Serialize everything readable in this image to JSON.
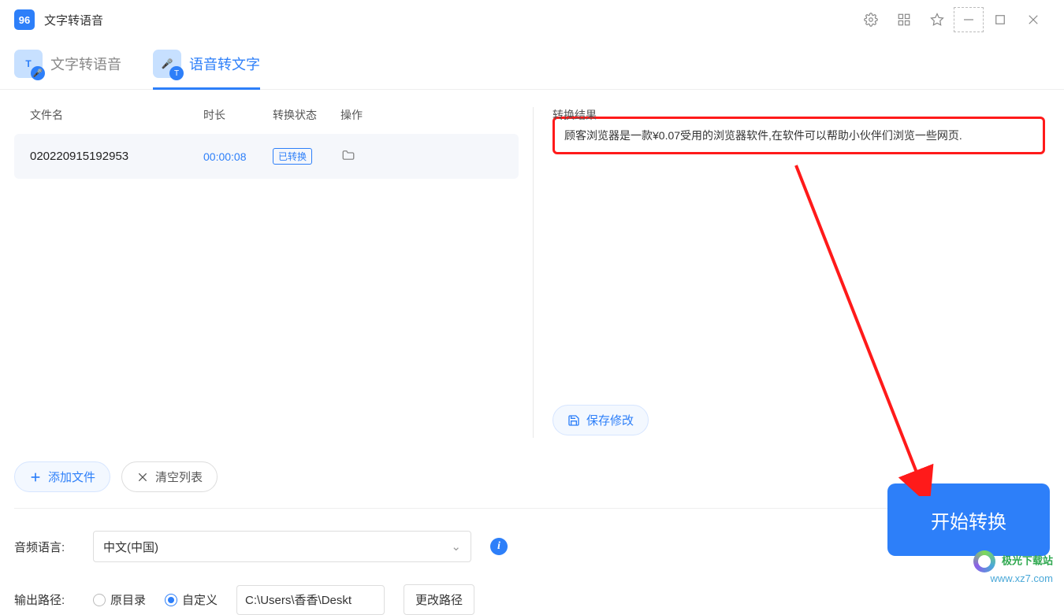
{
  "app": {
    "title": "文字转语音"
  },
  "tabs": {
    "tts": "文字转语音",
    "stt": "语音转文字"
  },
  "table": {
    "headers": {
      "name": "文件名",
      "duration": "时长",
      "status": "转换状态",
      "op": "操作"
    },
    "rows": [
      {
        "name": "020220915192953",
        "duration": "00:00:08",
        "status": "已转换"
      }
    ]
  },
  "result": {
    "header": "转换结果",
    "text": "顾客浏览器是一款¥0.07受用的浏览器软件,在软件可以帮助小伙伴们浏览一些网页."
  },
  "buttons": {
    "add": "添加文件",
    "clear": "清空列表",
    "save": "保存修改",
    "start": "开始转换",
    "change_path": "更改路径"
  },
  "settings": {
    "lang_label": "音频语言:",
    "lang_value": "中文(中国)",
    "out_label": "输出路径:",
    "radio_original": "原目录",
    "radio_custom": "自定义",
    "path": "C:\\Users\\香香\\Deskt"
  },
  "watermark": {
    "t1": "极光下载站",
    "t2": "www.xz7.com"
  }
}
